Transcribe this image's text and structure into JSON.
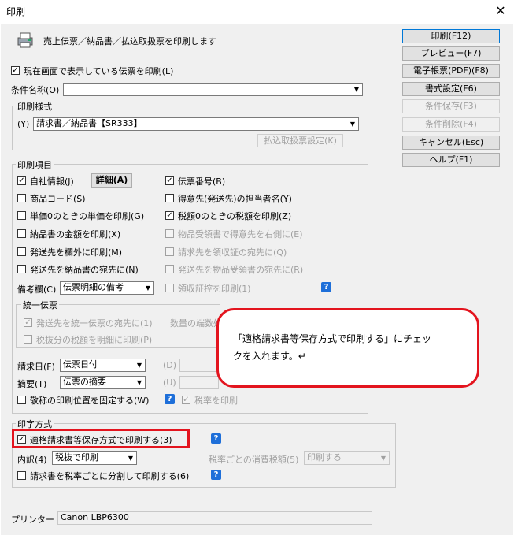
{
  "window": {
    "title": "印刷",
    "close_glyph": "✕"
  },
  "header": {
    "text": "売上伝票／納品書／払込取扱票を印刷します",
    "icon": "printer-icon"
  },
  "print_current_checkbox": {
    "label": "現在画面で表示している伝票を印刷(L)",
    "checked": true
  },
  "condition_name": {
    "label": "条件名称(O)",
    "value": ""
  },
  "print_style": {
    "legend": "印刷様式",
    "prefix": "(Y)",
    "value": "請求書／納品書【SR333】",
    "payment_button": "払込取扱票設定(K)"
  },
  "print_items": {
    "legend": "印刷項目",
    "company_info": {
      "label": "自社情報(J)",
      "checked": true
    },
    "detail_button": "詳細(A)",
    "slip_number": {
      "label": "伝票番号(B)",
      "checked": true
    },
    "product_code": {
      "label": "商品コード(S)",
      "checked": false
    },
    "customer_contact": {
      "label": "得意先(発送先)の担当者名(Y)",
      "checked": false
    },
    "unit_price_zero": {
      "label": "単価0のときの単価を印刷(G)",
      "checked": false
    },
    "tax_zero": {
      "label": "税額0のときの税額を印刷(Z)",
      "checked": true
    },
    "delivery_amount": {
      "label": "納品書の金額を印刷(X)",
      "checked": false
    },
    "receipt_right": {
      "label": "物品受領書で得意先を右側に(E)",
      "checked": false
    },
    "ship_to_margin": {
      "label": "発送先を欄外に印刷(M)",
      "checked": false
    },
    "bill_to_receipt": {
      "label": "請求先を領収証の宛先に(Q)",
      "checked": false
    },
    "ship_to_delivery": {
      "label": "発送先を納品書の宛先に(N)",
      "checked": false
    },
    "ship_to_goods_receipt": {
      "label": "発送先を物品受領書の宛先に(R)",
      "checked": false
    },
    "remarks": {
      "label": "備考欄(C)",
      "value": "伝票明細の備考"
    },
    "receipt_stub": {
      "label": "領収証控を印刷(1)",
      "checked": false
    }
  },
  "unified_slip": {
    "legend": "統一伝票",
    "ship_to_unified": {
      "label": "発送先を統一伝票の宛先に(1)",
      "checked": true
    },
    "fraction_label": "数量の端数処",
    "tax_excluded": {
      "label": "税抜分の税額を明細に印刷(P)",
      "checked": false
    }
  },
  "billing_date": {
    "label": "請求日(F)",
    "value": "伝票日付",
    "d_label": "(D)"
  },
  "summary": {
    "label": "摘要(T)",
    "value": "伝票の摘要",
    "u_label": "(U)"
  },
  "honorific": {
    "label": "敬称の印刷位置を固定する(W)",
    "checked": false
  },
  "tax_rate_print": {
    "label": "税率を印刷",
    "checked": true
  },
  "print_method": {
    "legend": "印字方式",
    "invoice_format": {
      "label": "適格請求書等保存方式で印刷する(3)",
      "checked": true
    },
    "breakdown": {
      "label": "内訳(4)",
      "value": "税抜で印刷"
    },
    "consumption_tax_label": "税率ごとの消費税額(5)",
    "consumption_tax_value": "印刷する",
    "split_invoice": {
      "label": "請求書を税率ごとに分割して印刷する(6)",
      "checked": false
    }
  },
  "printer": {
    "label": "プリンター",
    "value": "Canon LBP6300"
  },
  "buttons": {
    "print": "印刷(F12)",
    "preview": "プレビュー(F7)",
    "pdf": "電子帳票(PDF)(F8)",
    "form_settings": "書式設定(F6)",
    "save_condition": "条件保存(F3)",
    "delete_condition": "条件削除(F4)",
    "cancel": "キャンセル(Esc)",
    "help": "ヘルプ(F1)"
  },
  "help_icon_glyph": "?",
  "callout": {
    "line1": "「適格請求書等保存方式で印刷する」にチェッ",
    "line2": "クを入れます。↵"
  },
  "colors": {
    "highlight": "#e3141e",
    "help_blue": "#1e6fd9",
    "dialog_bg": "#f0f0f0"
  }
}
